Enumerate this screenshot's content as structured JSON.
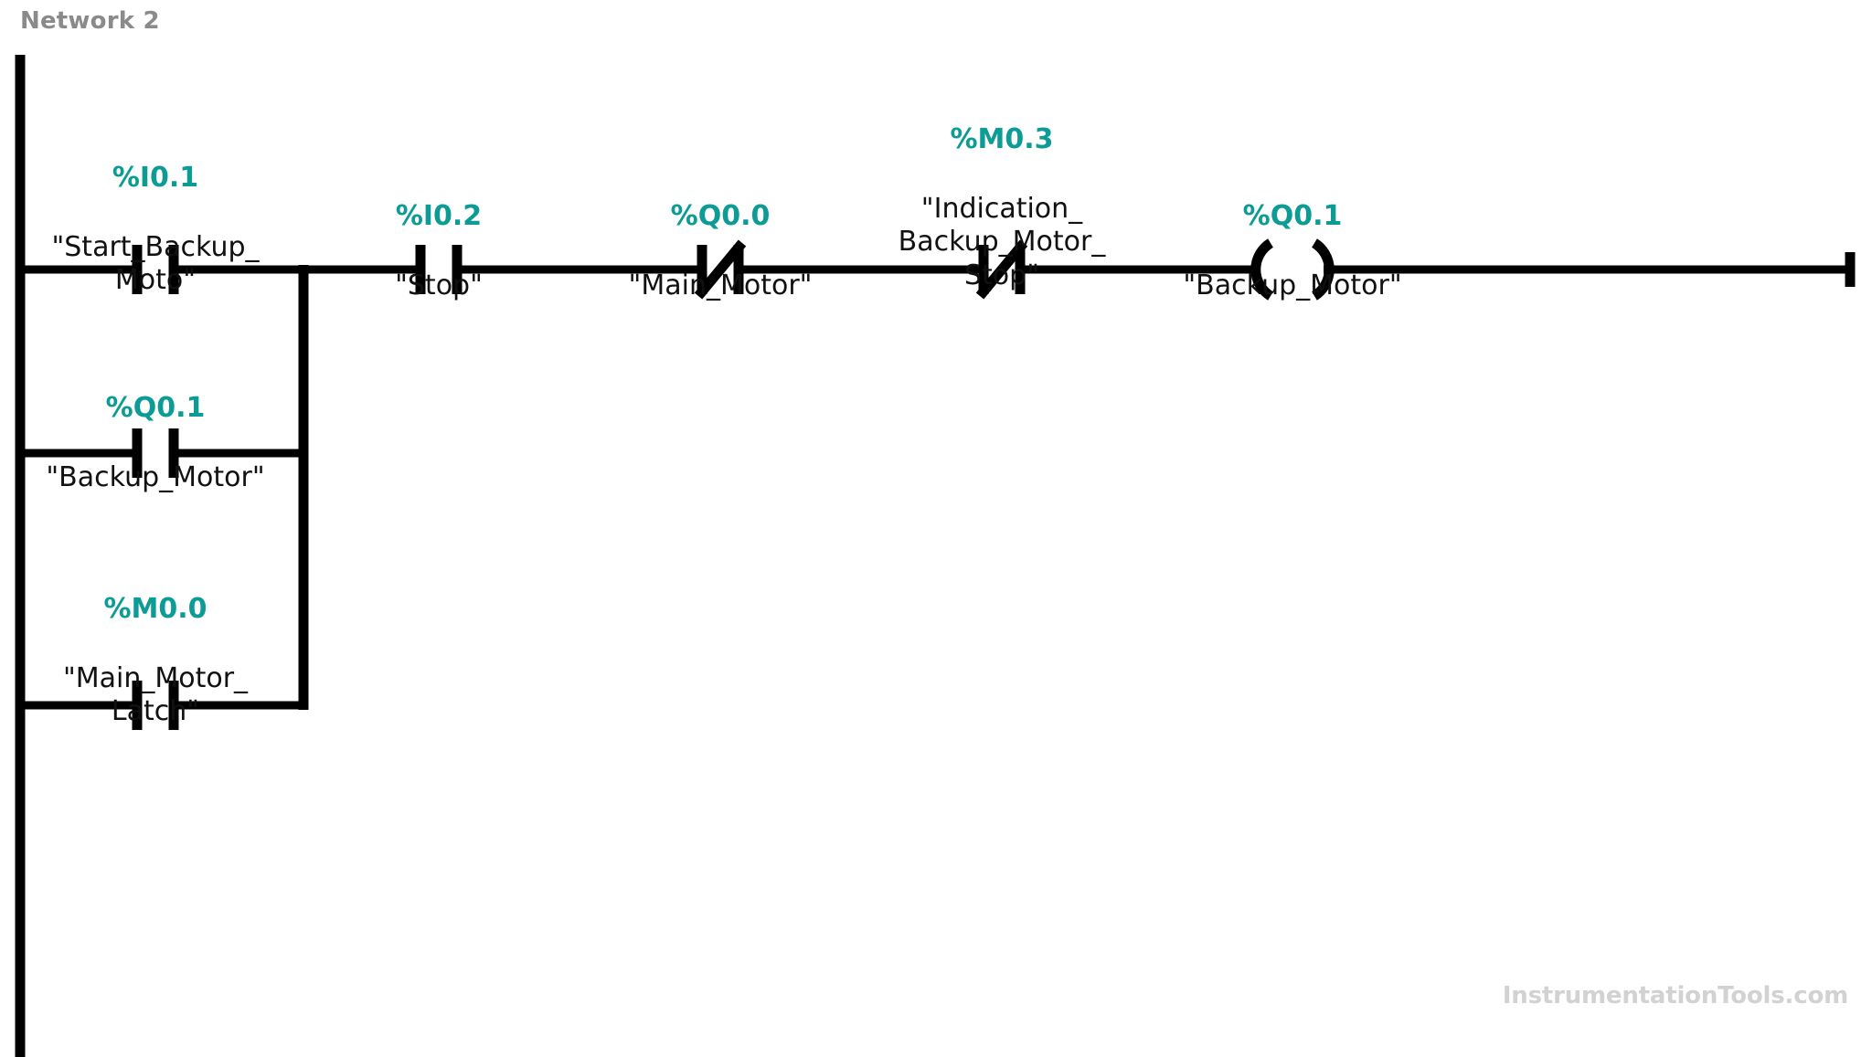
{
  "network": {
    "title": "Network 2"
  },
  "watermark": {
    "text": "InstrumentationTools.com"
  },
  "colors": {
    "address_teal": "#0d9b96",
    "symbol_black": "#111111",
    "wire_black": "#000000",
    "title_gray": "#8a8a8a",
    "watermark_gray": "#d2d2d2",
    "background": "#ffffff"
  },
  "elements": {
    "start_backup": {
      "address": "%I0.1",
      "symbol": "\"Start_Backup_\nMoto\"",
      "type": "contact-no"
    },
    "backup_motor_seal": {
      "address": "%Q0.1",
      "symbol": "\"Backup_Motor\"",
      "type": "contact-no"
    },
    "main_motor_latch": {
      "address": "%M0.0",
      "symbol": "\"Main_Motor_\nLatch\"",
      "type": "contact-no"
    },
    "stop": {
      "address": "%I0.2",
      "symbol": "\"Stop\"",
      "type": "contact-no"
    },
    "main_motor": {
      "address": "%Q0.0",
      "symbol": "\"Main_Motor\"",
      "type": "contact-nc"
    },
    "indication_backup_motor_stop": {
      "address": "%M0.3",
      "symbol": "\"Indication_\nBackup_Motor_\nStop\"",
      "type": "contact-nc"
    },
    "backup_motor_coil": {
      "address": "%Q0.1",
      "symbol": "\"Backup_Motor\"",
      "type": "coil"
    }
  }
}
